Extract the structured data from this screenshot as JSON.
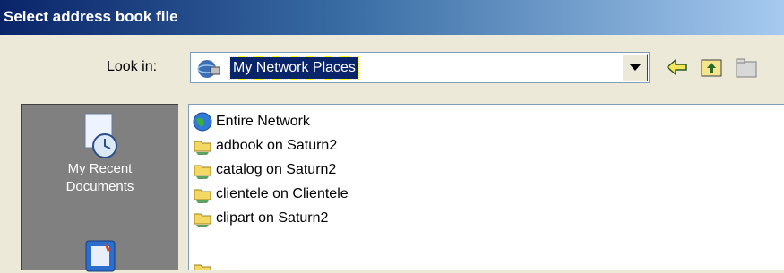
{
  "window": {
    "title": "Select address book file"
  },
  "toolbar": {
    "look_in_label": "Look in:",
    "look_in_value": "My Network Places",
    "icons": [
      "network-places-icon",
      "back-arrow-icon",
      "up-folder-icon",
      "new-folder-icon"
    ]
  },
  "places_bar": {
    "items": [
      {
        "label_line1": "My Recent",
        "label_line2": "Documents",
        "icon": "recent-documents-icon"
      },
      {
        "label_line1": "",
        "label_line2": "",
        "icon": "desktop-icon"
      }
    ]
  },
  "files": [
    {
      "name": "Entire Network",
      "icon": "globe-icon"
    },
    {
      "name": "adbook on Saturn2",
      "icon": "network-folder-icon"
    },
    {
      "name": "catalog on Saturn2",
      "icon": "network-folder-icon"
    },
    {
      "name": "clientele on Clientele",
      "icon": "network-folder-icon"
    },
    {
      "name": "clipart on Saturn2",
      "icon": "network-folder-icon"
    },
    {
      "name": "",
      "icon": "network-folder-icon"
    }
  ]
}
